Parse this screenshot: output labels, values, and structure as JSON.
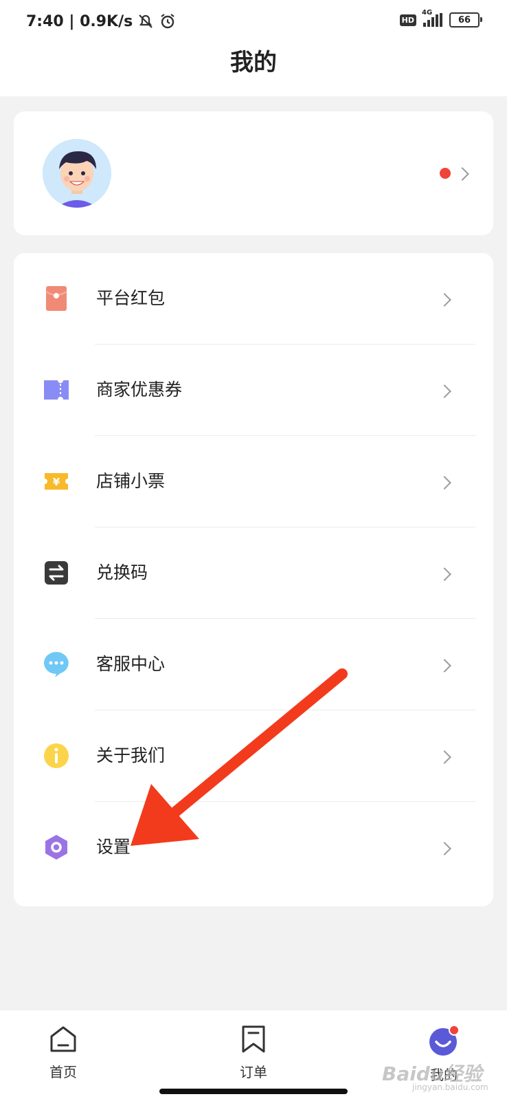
{
  "status_bar": {
    "time_speed": "7:40 | 0.9K/s",
    "hd": "HD",
    "network": "4G",
    "battery": "66"
  },
  "header": {
    "title": "我的"
  },
  "menu": [
    {
      "label": "平台红包",
      "icon": "red-packet-icon",
      "color": "#f08a76"
    },
    {
      "label": "商家优惠券",
      "icon": "coupon-icon",
      "color": "#8a8cf5"
    },
    {
      "label": "店铺小票",
      "icon": "receipt-icon",
      "color": "#f8b92a"
    },
    {
      "label": "兑换码",
      "icon": "exchange-icon",
      "color": "#3a3a3a"
    },
    {
      "label": "客服中心",
      "icon": "chat-icon",
      "color": "#6fc8f6"
    },
    {
      "label": "关于我们",
      "icon": "info-icon",
      "color": "#fbd44a"
    },
    {
      "label": "设置",
      "icon": "settings-icon",
      "color": "#9b74e4"
    }
  ],
  "tabs": [
    {
      "label": "首页",
      "icon": "home-icon"
    },
    {
      "label": "订单",
      "icon": "bookmark-icon"
    },
    {
      "label": "我的",
      "icon": "profile-icon"
    }
  ],
  "watermark": {
    "main": "Baidu经验",
    "sub": "jingyan.baidu.com"
  },
  "colors": {
    "accent": "#5a5ad8",
    "badge": "#f04438",
    "arrow": "#f23b1d"
  }
}
